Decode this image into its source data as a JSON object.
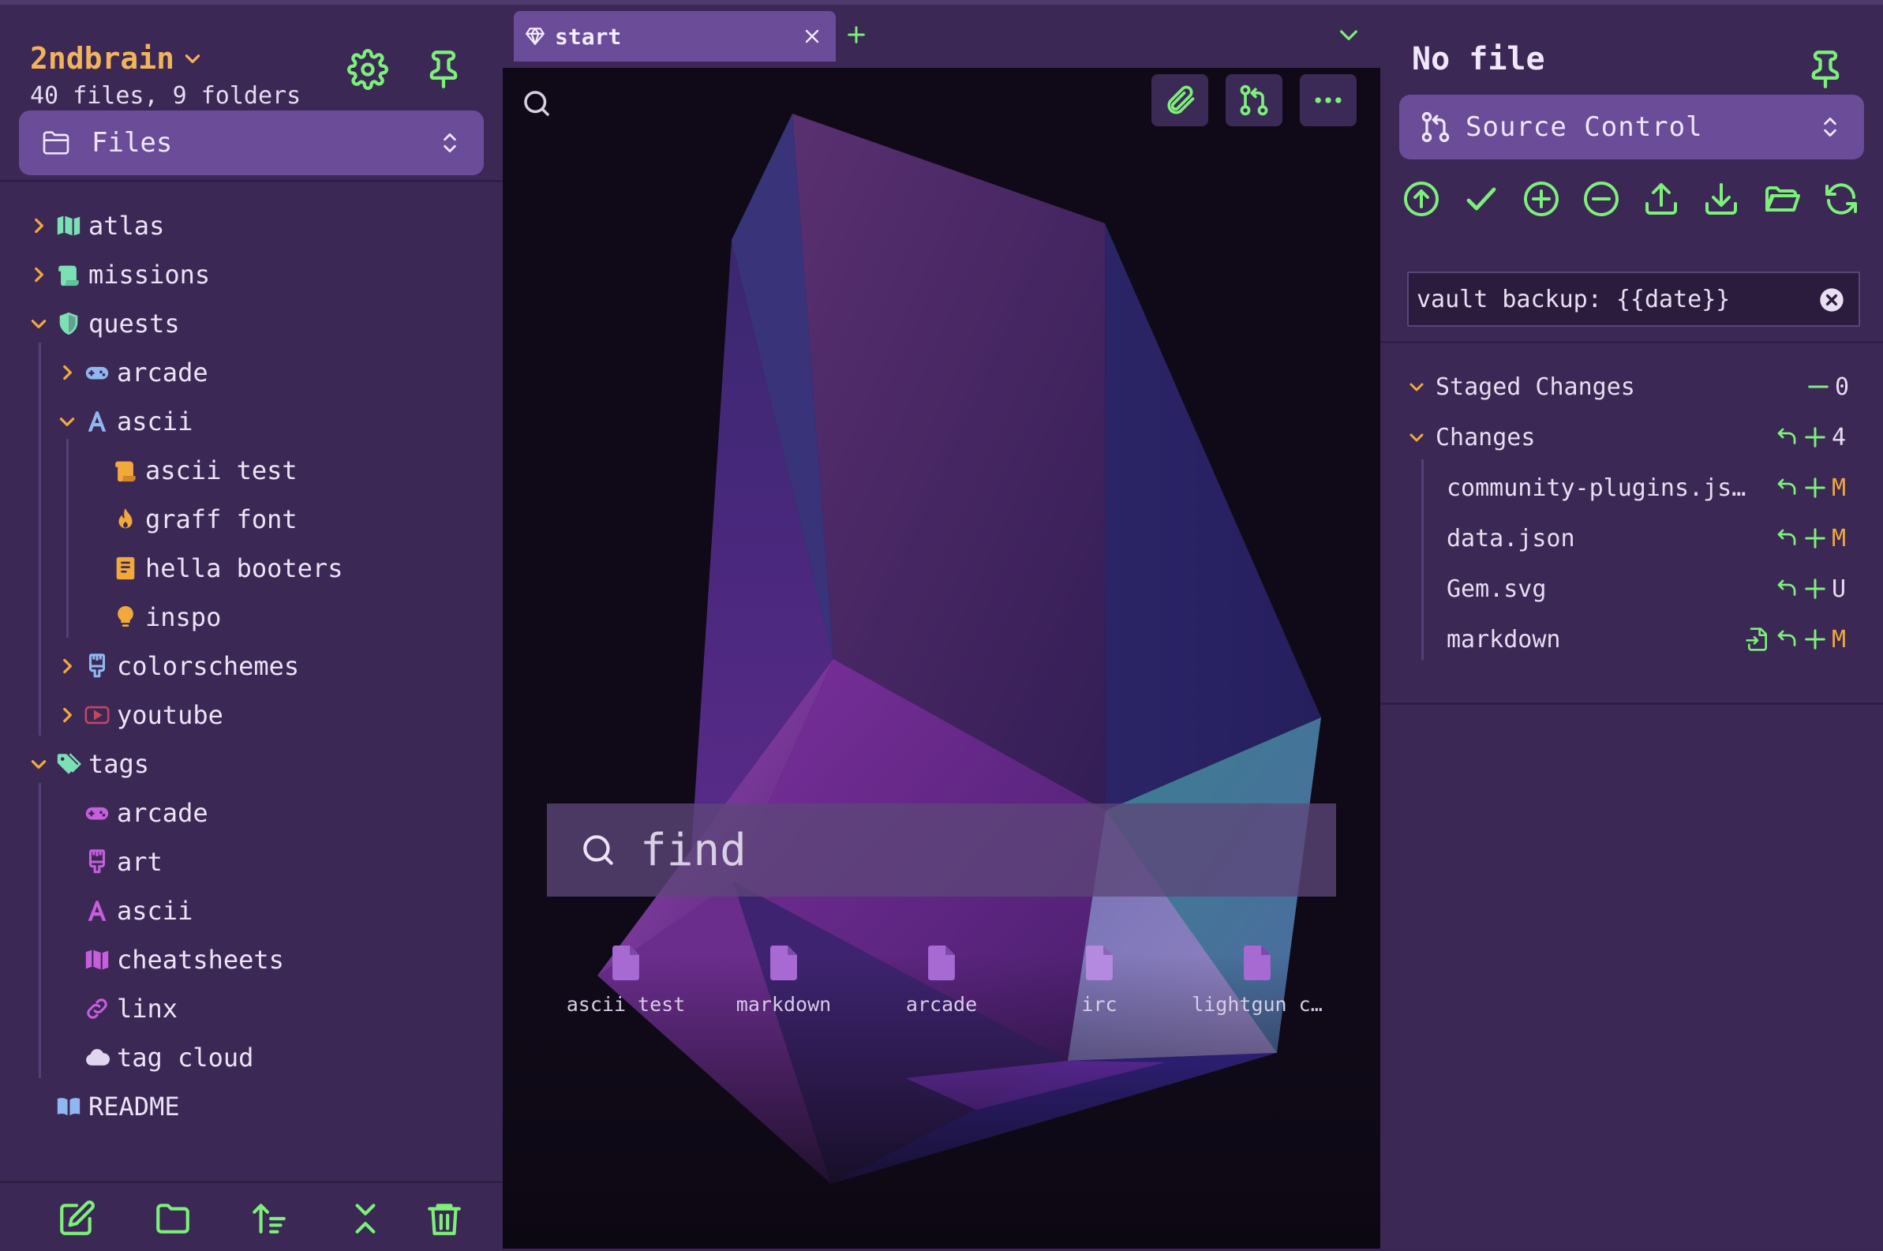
{
  "left": {
    "vault_name": "2ndbrain",
    "vault_stats": "40 files, 9 folders",
    "view_selector": "Files",
    "tree": {
      "atlas": "atlas",
      "missions": "missions",
      "quests": "quests",
      "arcade": "arcade",
      "ascii": "ascii",
      "ascii_test": "ascii test",
      "graff_font": "graff font",
      "hella_booters": "hella booters",
      "inspo": "inspo",
      "colorschemes": "colorschemes",
      "youtube": "youtube",
      "tags": "tags",
      "tag_arcade": "arcade",
      "tag_art": "art",
      "tag_ascii": "ascii",
      "tag_cheatsheets": "cheatsheets",
      "tag_linx": "linx",
      "tag_tag_cloud": "tag cloud",
      "readme": "README"
    }
  },
  "center": {
    "tab_title": "start",
    "find_placeholder": "find",
    "recent_files": [
      "ascii test",
      "markdown",
      "arcade",
      "irc",
      "lightgun c…"
    ]
  },
  "right": {
    "title": "No file",
    "view_selector": "Source Control",
    "commit_message": "vault backup: {{date}}",
    "staged": {
      "label": "Staged Changes",
      "count": "0"
    },
    "changes": {
      "label": "Changes",
      "count": "4"
    },
    "files": [
      {
        "name": "community-plugins.js…",
        "status": "M"
      },
      {
        "name": "data.json",
        "status": "M"
      },
      {
        "name": "Gem.svg",
        "status": "U"
      },
      {
        "name": "markdown",
        "status": "M"
      }
    ]
  },
  "colors": {
    "accent_green": "#7cf078",
    "accent_orange": "#f2a93b",
    "panel_bg": "#3c2855",
    "selected_bg": "#6a4c99"
  }
}
